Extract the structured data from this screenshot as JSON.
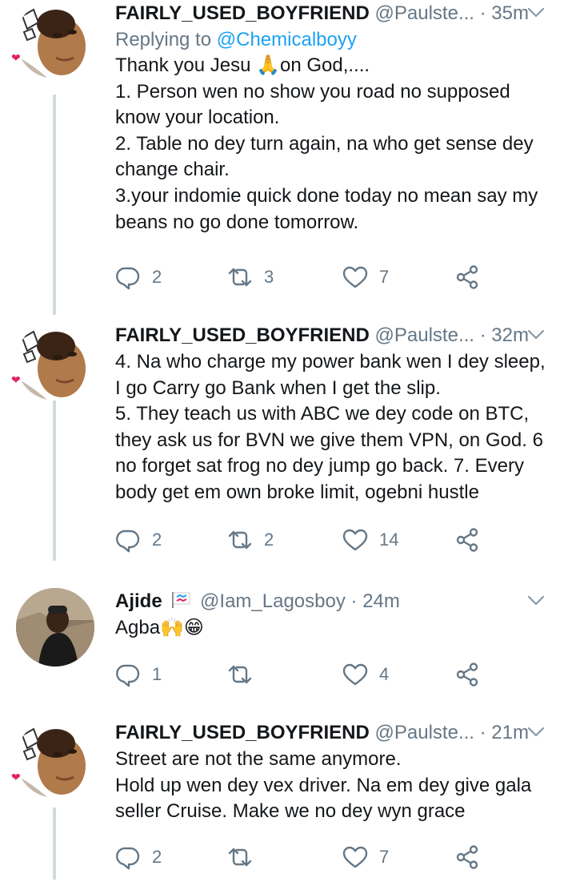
{
  "tweets": [
    {
      "name": "FAIRLY_USED_BOYFRIEND",
      "handle": "@Paulste...",
      "sep": "·",
      "time": "35m",
      "reply_prefix": "Replying to ",
      "reply_handle": "@Chemicalboyy",
      "text": "Thank you Jesu 🙏on God,....\n1. Person wen no show you road no supposed know your location.\n2. Table no dey turn again, na who get sense dey change chair.\n3.your indomie quick done today no mean say my beans no go done tomorrow.",
      "replies": "2",
      "retweets": "3",
      "likes": "7"
    },
    {
      "name": "FAIRLY_USED_BOYFRIEND",
      "handle": "@Paulste...",
      "sep": "·",
      "time": "32m",
      "text": "4. Na who charge my power bank wen I dey sleep, I go Carry go Bank when I get the slip.\n5. They teach us with ABC we dey code on BTC, they ask us for BVN we give them VPN, on God. 6 no forget sat frog no dey jump go back. 7. Every body get em own broke limit, ogebni hustle",
      "replies": "2",
      "retweets": "2",
      "likes": "14"
    },
    {
      "name": "Ajide",
      "handle": "@Iam_Lagosboy",
      "sep": "·",
      "time": "24m",
      "text": "Agba🙌😁",
      "replies": "1",
      "retweets": "",
      "likes": "4"
    },
    {
      "name": "FAIRLY_USED_BOYFRIEND",
      "handle": "@Paulste...",
      "sep": "·",
      "time": "21m",
      "text": "Street are not the same anymore.\nHold up wen dey vex driver. Na em dey give gala seller Cruise. Make we no dey wyn grace",
      "replies": "2",
      "retweets": "",
      "likes": "7"
    }
  ],
  "colors": {
    "text": "#14171a",
    "secondary": "#657786",
    "link": "#1da1f2",
    "thread_line": "#d3dae0"
  },
  "icons": [
    "reply-icon",
    "retweet-icon",
    "like-icon",
    "share-icon",
    "chevron-down-icon"
  ]
}
